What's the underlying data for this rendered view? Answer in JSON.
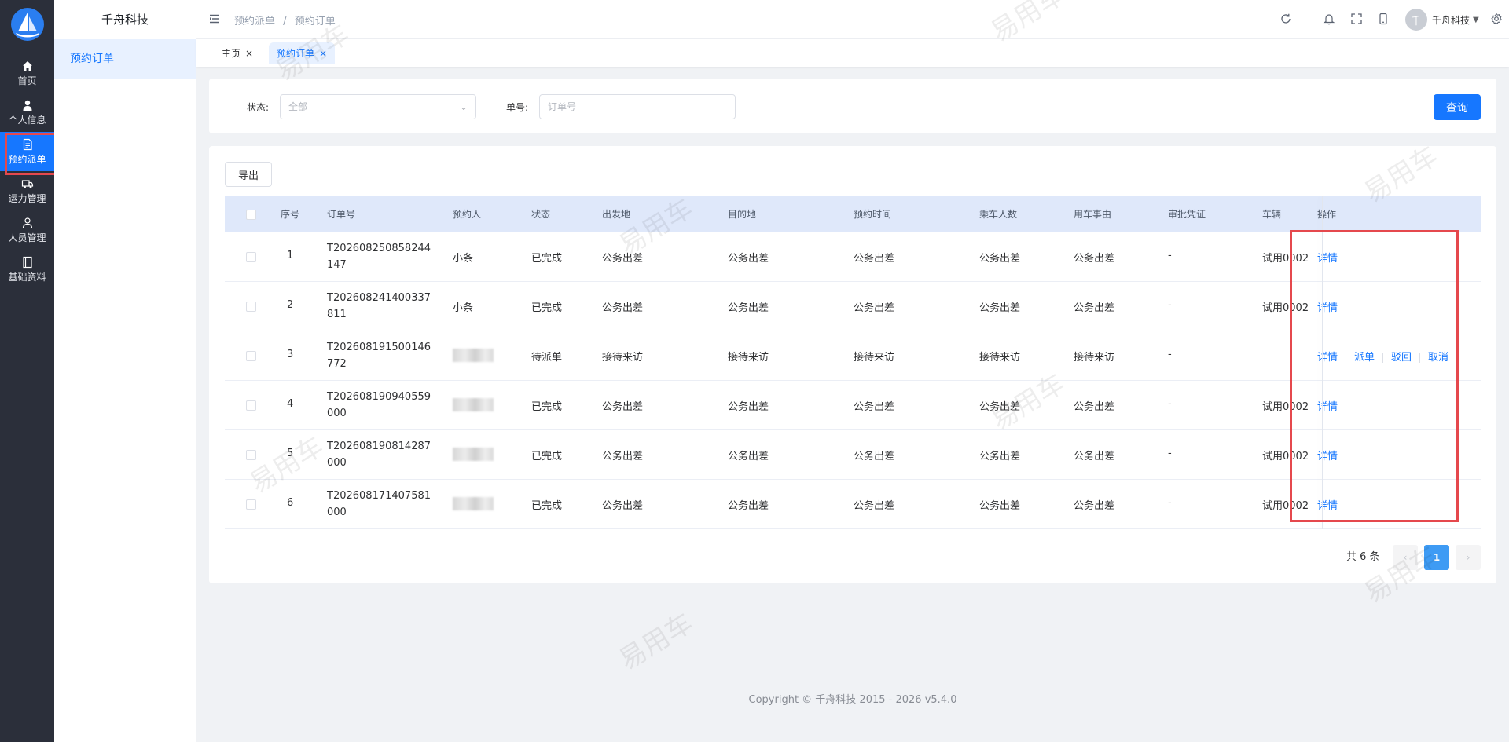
{
  "sidebar": {
    "items": [
      {
        "label": "首页",
        "icon": "home-icon"
      },
      {
        "label": "个人信息",
        "icon": "user-icon"
      },
      {
        "label": "预约派单",
        "icon": "document-icon"
      },
      {
        "label": "运力管理",
        "icon": "truck-icon"
      },
      {
        "label": "人员管理",
        "icon": "person-icon"
      },
      {
        "label": "基础资料",
        "icon": "book-icon"
      }
    ]
  },
  "submenu": {
    "title": "千舟科技",
    "items": [
      {
        "label": "预约订单"
      }
    ]
  },
  "header": {
    "breadcrumb": [
      "预约派单",
      "/",
      "预约订单"
    ],
    "user": {
      "initial": "千",
      "name": "千舟科技"
    }
  },
  "tabs": [
    {
      "label": "主页",
      "close": "×"
    },
    {
      "label": "预约订单",
      "close": "×"
    }
  ],
  "search": {
    "status_label": "状态:",
    "status_value": "全部",
    "order_label": "单号:",
    "order_placeholder": "订单号",
    "query_button": "查询"
  },
  "table": {
    "export_button": "导出",
    "columns": [
      "序号",
      "订单号",
      "预约人",
      "状态",
      "出发地",
      "目的地",
      "预约时间",
      "乘车人数",
      "用车事由",
      "审批凭证",
      "车辆",
      "操作"
    ],
    "rows": [
      {
        "no": "1",
        "order": "T202608250858244147",
        "person": "小条",
        "status": "已完成",
        "from": "公务出差",
        "to": "公务出差",
        "time": "公务出差",
        "count": "公务出差",
        "reason": "公务出差",
        "proof": "-",
        "vehicle": "试用0002",
        "actions": [
          "详情"
        ]
      },
      {
        "no": "2",
        "order": "T202608241400337811",
        "person": "小条",
        "status": "已完成",
        "from": "公务出差",
        "to": "公务出差",
        "time": "公务出差",
        "count": "公务出差",
        "reason": "公务出差",
        "proof": "-",
        "vehicle": "试用0002",
        "actions": [
          "详情"
        ]
      },
      {
        "no": "3",
        "order": "T202608191500146772",
        "person": "",
        "status": "待派单",
        "from": "接待来访",
        "to": "接待来访",
        "time": "接待来访",
        "count": "接待来访",
        "reason": "接待来访",
        "proof": "-",
        "vehicle": "",
        "actions": [
          "详情",
          "派单",
          "驳回",
          "取消"
        ]
      },
      {
        "no": "4",
        "order": "T202608190940559000",
        "person": "",
        "status": "已完成",
        "from": "公务出差",
        "to": "公务出差",
        "time": "公务出差",
        "count": "公务出差",
        "reason": "公务出差",
        "proof": "-",
        "vehicle": "试用0002",
        "actions": [
          "详情"
        ]
      },
      {
        "no": "5",
        "order": "T202608190814287000",
        "person": "",
        "status": "已完成",
        "from": "公务出差",
        "to": "公务出差",
        "time": "公务出差",
        "count": "公务出差",
        "reason": "公务出差",
        "proof": "-",
        "vehicle": "试用0002",
        "actions": [
          "详情"
        ]
      },
      {
        "no": "6",
        "order": "T202608171407581000",
        "person": "",
        "status": "已完成",
        "from": "公务出差",
        "to": "公务出差",
        "time": "公务出差",
        "count": "公务出差",
        "reason": "公务出差",
        "proof": "-",
        "vehicle": "试用0002",
        "actions": [
          "详情"
        ]
      }
    ]
  },
  "pagination": {
    "total": "共 6 条",
    "current": "1",
    "prev": "‹",
    "next": "›"
  },
  "footer": {
    "copyright": "Copyright © 千舟科技 2015 - 2026 v5.4.0"
  },
  "watermark": "易用车",
  "colors": {
    "accent": "#1677ff",
    "rail": "#2b2f3a",
    "highlight": "#e5484d"
  }
}
